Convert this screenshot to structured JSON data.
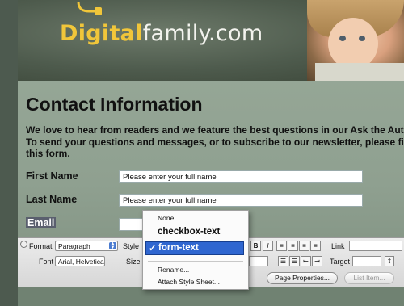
{
  "site": {
    "logo_part1": "Digital",
    "logo_part2": "family.com"
  },
  "page": {
    "title": "Contact Information",
    "intro_line1": "We love to hear from readers and we feature the best questions in our Ask the Auth",
    "intro_line2": "To send your questions and messages, or to subscribe to our newsletter, please fi",
    "intro_line3": "this form."
  },
  "form": {
    "first_name_label": "First Name",
    "first_name_value": "Please enter your full name",
    "last_name_label": "Last Name",
    "last_name_value": "Please enter your full name",
    "email_label": "Email",
    "email_value": ""
  },
  "properties_panel": {
    "format_label": "Format",
    "format_value": "Paragraph",
    "style_label": "Style",
    "font_label": "Font",
    "font_value": "Arial, Helvetica",
    "size_label": "Size",
    "bold_label": "B",
    "italic_label": "I",
    "link_label": "Link",
    "target_label": "Target",
    "page_properties_button": "Page Properties...",
    "list_item_button": "List Item..."
  },
  "style_menu": {
    "items": [
      "None",
      "checkbox-text",
      "form-text",
      "Rename...",
      "Attach Style Sheet..."
    ],
    "selected": "form-text",
    "check_glyph": "✓"
  },
  "colors": {
    "logo_accent": "#f1c63a",
    "menu_highlight": "#2f66d0"
  }
}
